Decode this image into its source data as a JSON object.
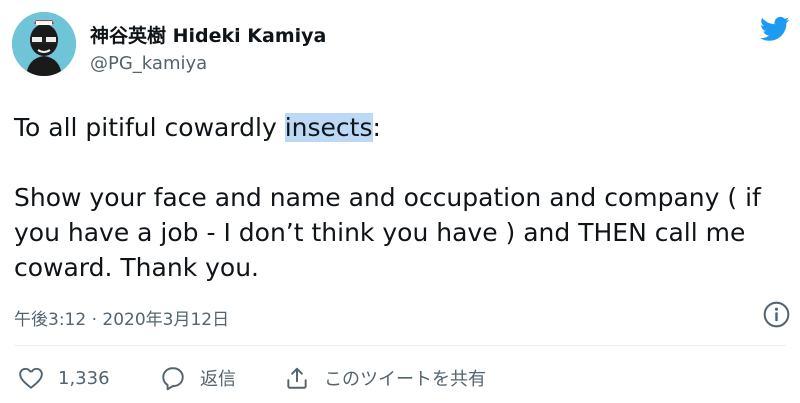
{
  "author": {
    "display_name": "神谷英樹 Hideki Kamiya",
    "handle": "@PG_kamiya"
  },
  "tweet": {
    "line1_before": "To all pitiful cowardly ",
    "line1_highlight": "insects",
    "line1_after": ":",
    "body": "Show your face and name and occupation and company ( if you have a job - I don’t think you have ) and THEN call me coward. Thank you."
  },
  "meta": {
    "timestamp": "午後3:12 · 2020年3月12日"
  },
  "actions": {
    "like_count": "1,336",
    "reply_label": "返信",
    "share_label": "このツイートを共有"
  },
  "colors": {
    "brand": "#1d9bf0",
    "text": "#0f1419",
    "secondary": "#536471",
    "highlight": "#bcd8f5"
  },
  "icons": [
    "avatar-image",
    "twitter-bird-icon",
    "info-icon",
    "heart-icon",
    "reply-icon",
    "share-icon"
  ]
}
